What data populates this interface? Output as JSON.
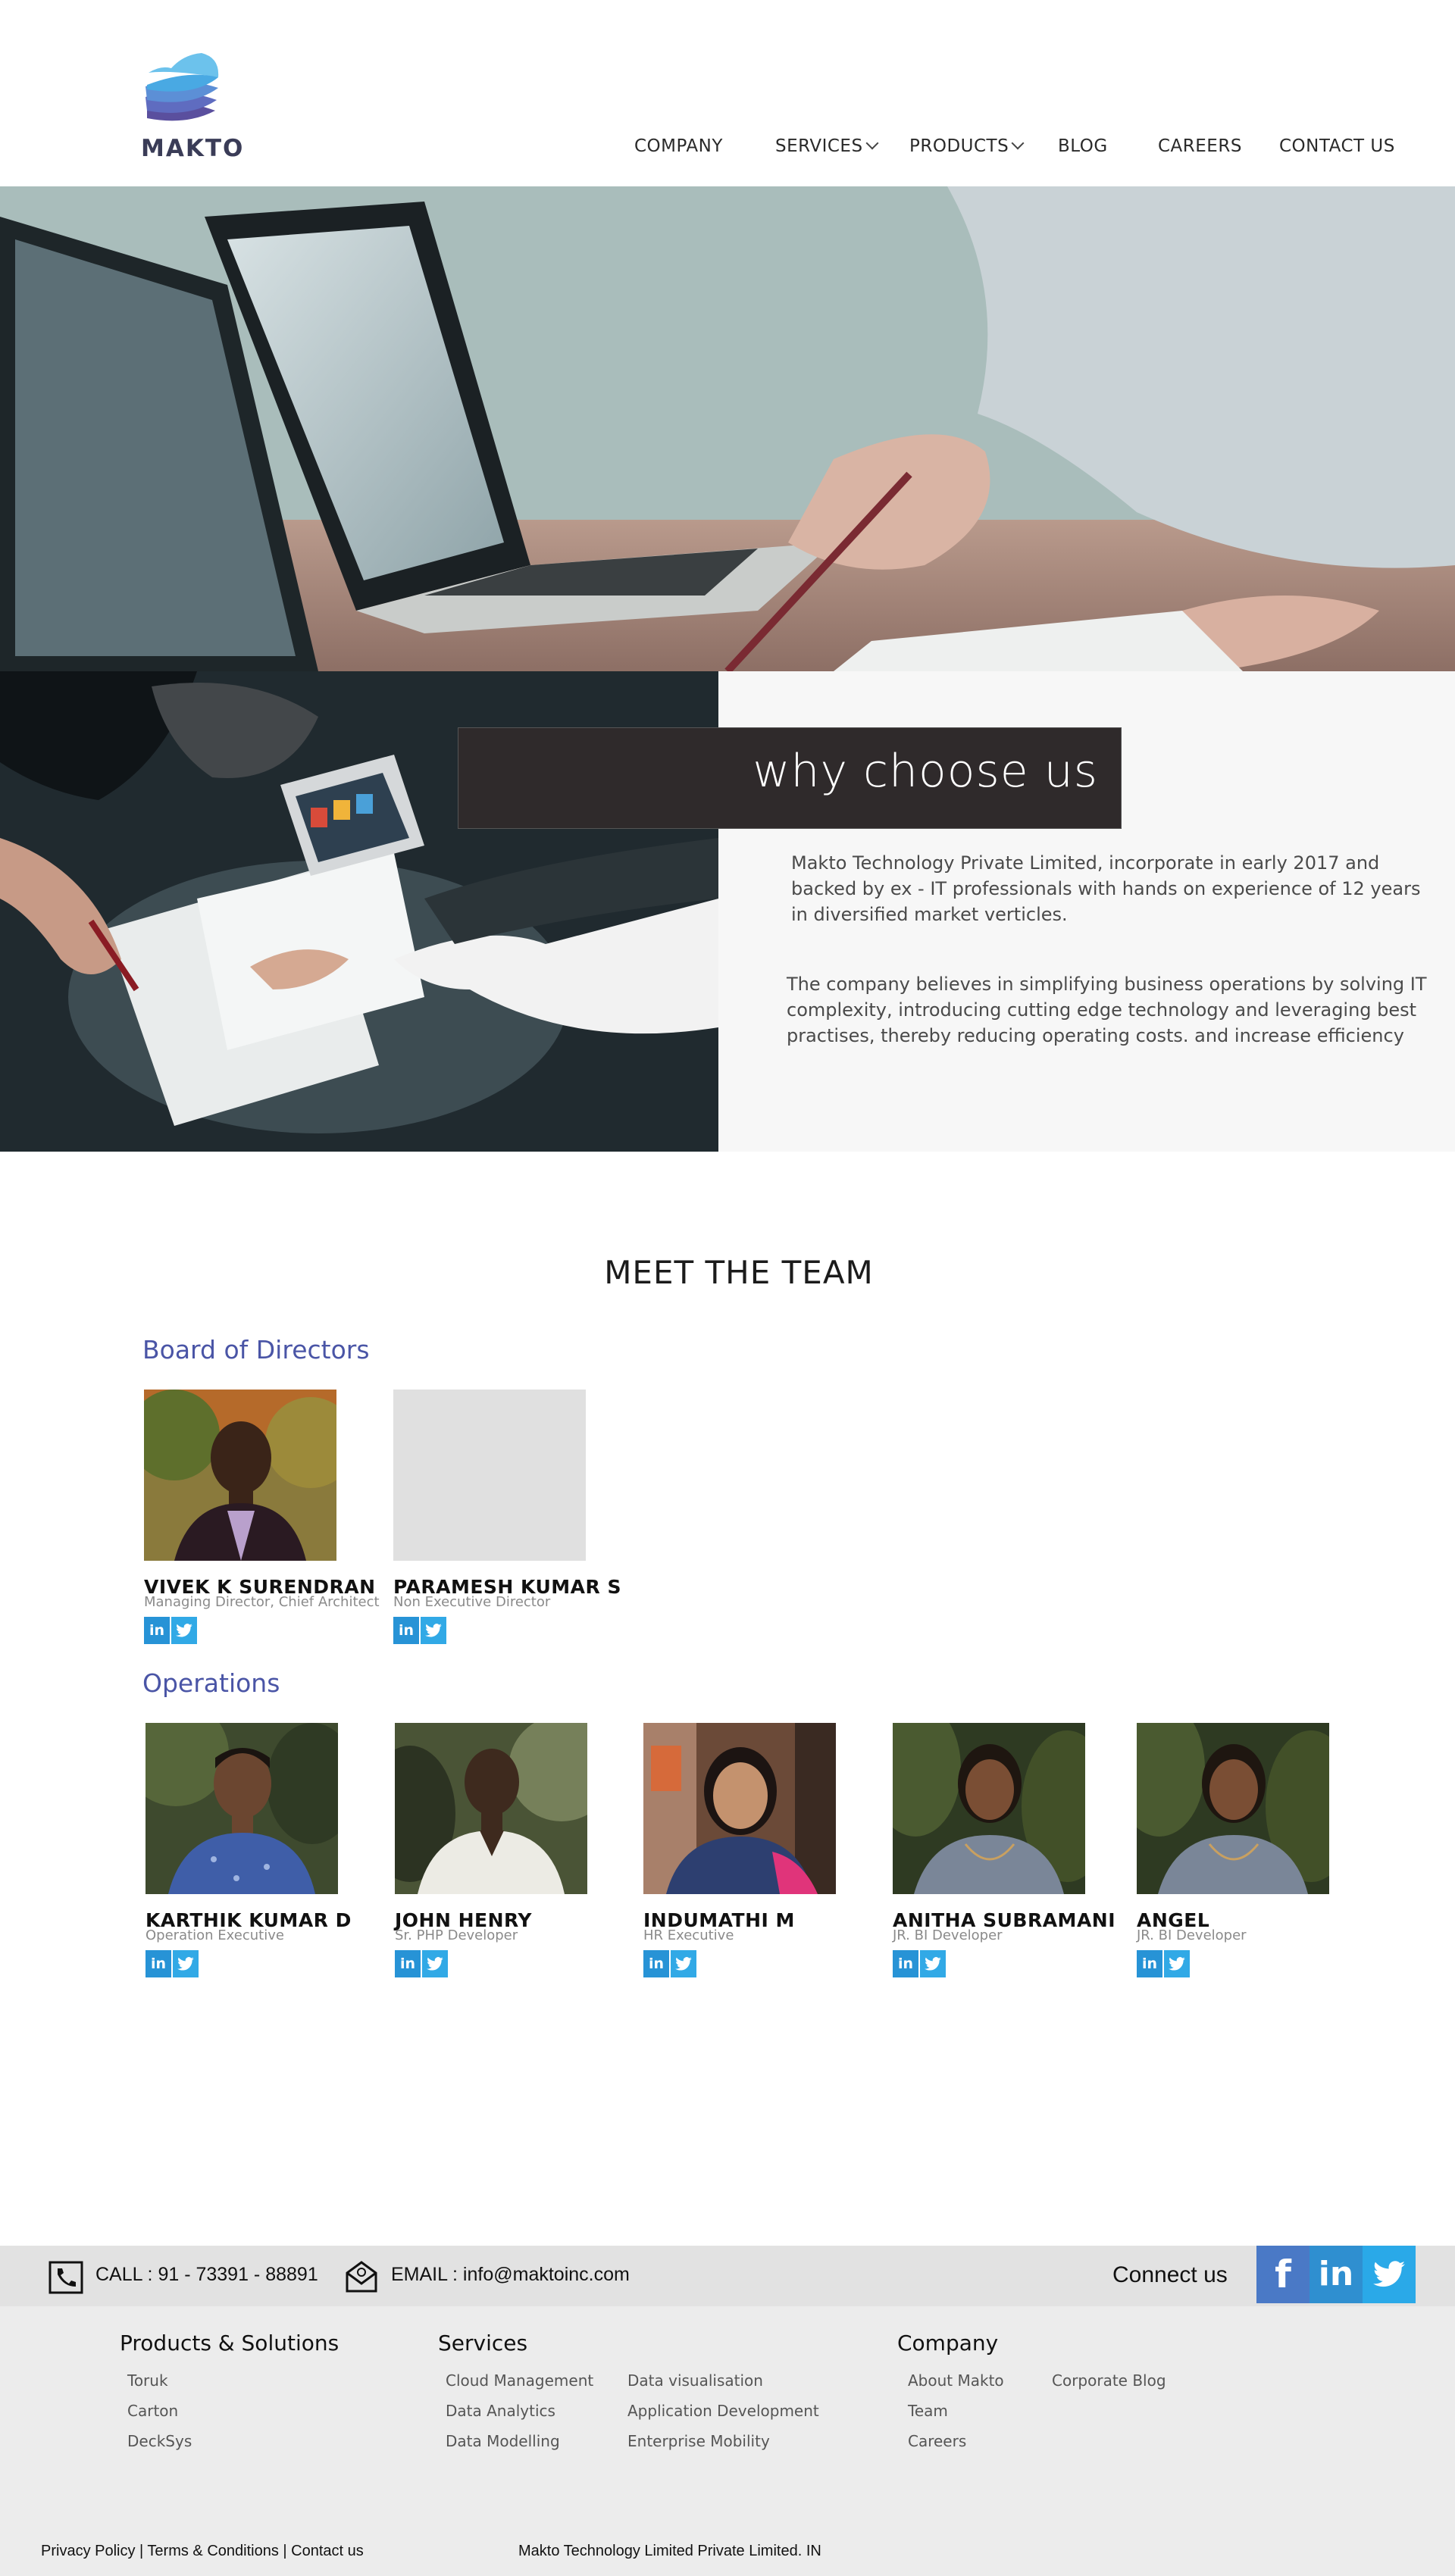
{
  "logo": {
    "text": "MAKTO"
  },
  "nav": {
    "company": "COMPANY",
    "services": "SERVICES",
    "products": "PRODUCTS",
    "blog": "BLOG",
    "careers": "CAREERS",
    "contact": "CONTACT US"
  },
  "why": {
    "title": "why choose us",
    "p1_lines": [
      "Makto Technology Private Limited, incorporate in early 2017 and",
      "backed by ex - IT professionals with hands on experience of 12 years",
      "in diversified market verticles."
    ],
    "p2_lines": [
      "The company believes in simplifying business operations by solving IT",
      "complexity, introducing cutting edge technology and leveraging best",
      "practises, thereby reducing operating costs. and increase efficiency"
    ]
  },
  "team": {
    "title": "MEET THE TEAM",
    "board_title": "Board of Directors",
    "operations_title": "Operations",
    "board": [
      {
        "name": "VIVEK K SURENDRAN",
        "role": "Managing Director, Chief Architect"
      },
      {
        "name": "PARAMESH KUMAR S",
        "role": "Non Executive Director"
      }
    ],
    "operations": [
      {
        "name": "KARTHIK KUMAR D",
        "role": "Operation Executive"
      },
      {
        "name": "JOHN HENRY",
        "role": "Sr. PHP Developer"
      },
      {
        "name": "INDUMATHI M",
        "role": "HR Executive"
      },
      {
        "name": "ANITHA SUBRAMANI",
        "role": "JR. BI Developer"
      },
      {
        "name": "ANGEL",
        "role": "JR. BI Developer"
      }
    ],
    "social_linkedin": "in",
    "social_twitter": "t"
  },
  "contact": {
    "call": "CALL : 91 - 73391 - 88891",
    "email": "EMAIL : info@maktoinc.com",
    "connect": "Connect us",
    "facebook": "f",
    "linkedin": "in"
  },
  "footer": {
    "products_title": "Products & Solutions",
    "products": [
      "Toruk",
      "Carton",
      "DeckSys"
    ],
    "services_title": "Services",
    "services_col1": [
      "Cloud Management",
      "Data Analytics",
      "Data Modelling"
    ],
    "services_col2": [
      "Data visualisation",
      "Application Development",
      "Enterprise Mobility"
    ],
    "company_title": "Company",
    "company_col1": [
      "About Makto",
      "Team",
      "Careers"
    ],
    "company_col2": [
      "Corporate Blog"
    ],
    "legal": "Privacy Policy | Terms & Conditions | Contact us",
    "copyright": "Makto Technology Limited Private Limited. IN"
  },
  "colors": {
    "accent": "#4a55a6",
    "linkedin": "#2793d6",
    "twitter": "#31a9e6",
    "facebook": "#3b5998",
    "banner": "#2f2a2b"
  }
}
